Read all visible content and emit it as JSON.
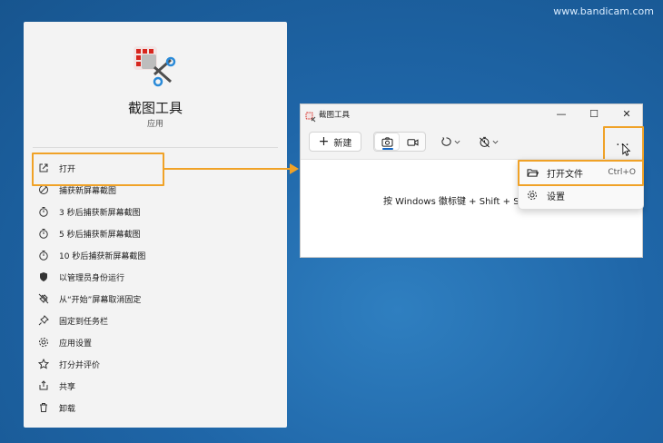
{
  "watermark": "www.bandicam.com",
  "start_menu": {
    "app_name": "截图工具",
    "app_type": "应用",
    "items": [
      {
        "label": "打开",
        "icon": "open-external-icon"
      },
      {
        "label": "捕获新屏幕截图",
        "icon": "capture-icon"
      },
      {
        "label": "3 秒后捕获新屏幕截图",
        "icon": "timer-icon"
      },
      {
        "label": "5 秒后捕获新屏幕截图",
        "icon": "timer-icon"
      },
      {
        "label": "10 秒后捕获新屏幕截图",
        "icon": "timer-icon"
      },
      {
        "label": "以管理员身份运行",
        "icon": "shield-icon"
      },
      {
        "label": "从“开始”屏幕取消固定",
        "icon": "unpin-icon"
      },
      {
        "label": "固定到任务栏",
        "icon": "pin-icon"
      },
      {
        "label": "应用设置",
        "icon": "gear-icon"
      },
      {
        "label": "打分并评价",
        "icon": "star-icon"
      },
      {
        "label": "共享",
        "icon": "share-icon"
      },
      {
        "label": "卸载",
        "icon": "trash-icon"
      }
    ]
  },
  "snip_window": {
    "title": "截图工具",
    "new_label": "新建",
    "hint": "按 Windows 徽标键 + Shift + S",
    "more_label": "..."
  },
  "dropdown": {
    "items": [
      {
        "label": "打开文件",
        "shortcut": "Ctrl+O",
        "icon": "folder-open-icon"
      },
      {
        "label": "设置",
        "shortcut": "",
        "icon": "gear-icon"
      }
    ]
  },
  "colors": {
    "accent": "#f0a227",
    "selection_blue": "#1366c4",
    "desktop": "#1f66a8"
  }
}
